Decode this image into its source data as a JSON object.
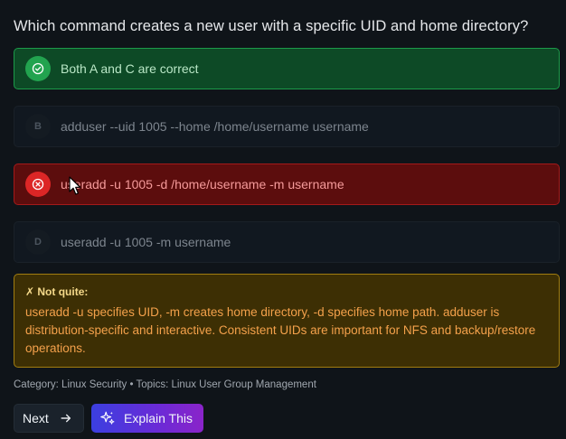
{
  "question": "Which command creates a new user with a specific UID and home directory?",
  "options": [
    {
      "badge": "",
      "text": "Both A and C are correct",
      "state": "correct"
    },
    {
      "badge": "B",
      "text": "adduser --uid 1005 --home /home/username username",
      "state": "neutral"
    },
    {
      "badge": "",
      "text": "useradd -u 1005 -d /home/username -m username",
      "state": "incorrect"
    },
    {
      "badge": "D",
      "text": "useradd -u 1005 -m username",
      "state": "neutral"
    }
  ],
  "feedback": {
    "title": "✗ Not quite:",
    "body": "useradd -u specifies UID, -m creates home directory, -d specifies home path. adduser is distribution-specific and interactive. Consistent UIDs are important for NFS and backup/restore operations."
  },
  "meta": "Category: Linux Security • Topics: Linux User Group Management",
  "buttons": {
    "next": "Next",
    "explain": "Explain This"
  },
  "icons": {
    "correct": "check-circle-icon",
    "incorrect": "x-circle-icon",
    "next": "arrow-right-icon",
    "explain": "sparkles-icon"
  },
  "colors": {
    "correct": "#22a34f",
    "incorrect": "#dc2626",
    "warning_border": "#a17d10",
    "explain_gradient_start": "#3b3fe0",
    "explain_gradient_end": "#8a24c9"
  }
}
